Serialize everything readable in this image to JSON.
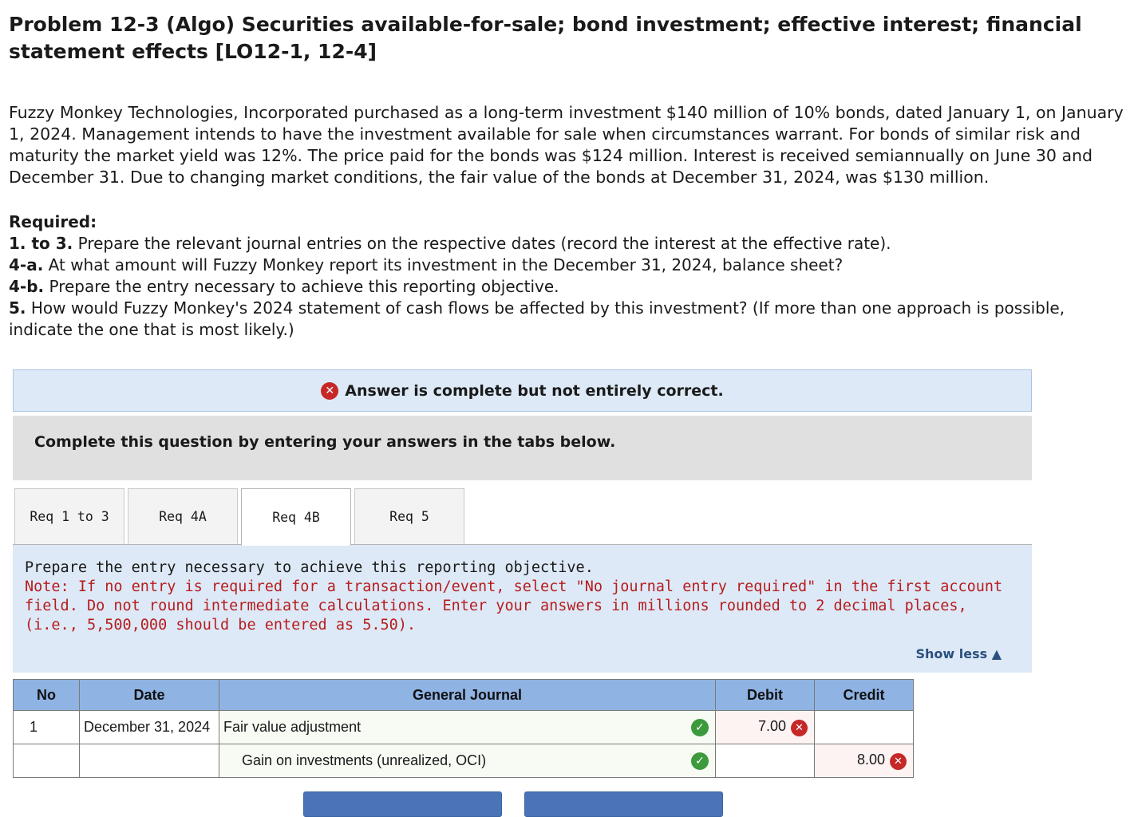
{
  "problem": {
    "title": "Problem 12-3 (Algo) Securities available-for-sale; bond investment; effective interest; financial statement effects [LO12-1, 12-4]",
    "intro": "Fuzzy Monkey Technologies, Incorporated purchased as a long-term investment $140 million of 10% bonds, dated January 1, on January 1, 2024. Management intends to have the investment available for sale when circumstances warrant. For bonds of similar risk and maturity the market yield was 12%. The price paid for the bonds was $124 million. Interest is received semiannually on June 30 and December 31. Due to changing market conditions, the fair value of the bonds at December 31, 2024, was $130 million.",
    "required_label": "Required:",
    "requirements": [
      {
        "label": "1. to 3.",
        "text": " Prepare the relevant journal entries on the respective dates (record the interest at the effective rate)."
      },
      {
        "label": "4-a.",
        "text": " At what amount will Fuzzy Monkey report its investment in the December 31, 2024, balance sheet?"
      },
      {
        "label": "4-b.",
        "text": " Prepare the entry necessary to achieve this reporting objective."
      },
      {
        "label": "5.",
        "text": " How would Fuzzy Monkey's 2024 statement of cash flows be affected by this investment? (If more than one approach is possible, indicate the one that is most likely.)"
      }
    ]
  },
  "feedback": {
    "banner": "Answer is complete but not entirely correct.",
    "banner_icon": "x-circle-icon",
    "complete_prompt": "Complete this question by entering your answers in the tabs below."
  },
  "tabs": [
    {
      "label": "Req 1 to 3",
      "active": false
    },
    {
      "label": "Req 4A",
      "active": false
    },
    {
      "label": "Req 4B",
      "active": true
    },
    {
      "label": "Req 5",
      "active": false
    }
  ],
  "panel": {
    "instruction": "Prepare the entry necessary to achieve this reporting objective.",
    "note": "Note: If no entry is required for a transaction/event, select \"No journal entry required\" in the first account field. Do not round intermediate calculations. Enter your answers in millions rounded to 2 decimal places, (i.e., 5,500,000 should be entered as 5.50).",
    "show_less": "Show less"
  },
  "journal": {
    "headers": {
      "no": "No",
      "date": "Date",
      "account": "General Journal",
      "debit": "Debit",
      "credit": "Credit"
    },
    "rows": [
      {
        "no": "1",
        "date": "December 31, 2024",
        "account": "Fair value adjustment",
        "account_correct": true,
        "debit": "7.00",
        "debit_correct": false,
        "credit": ""
      },
      {
        "no": "",
        "date": "",
        "account": "Gain on investments (unrealized, OCI)",
        "account_correct": true,
        "debit": "",
        "credit": "8.00",
        "credit_correct": false
      }
    ]
  },
  "colors": {
    "banner_bg": "#dde9f7",
    "header_bg": "#8fb3e3",
    "note_red": "#b71c1c",
    "correct_green": "#3c9a3c",
    "incorrect_red": "#c62828",
    "button_blue": "#4a74b6"
  }
}
